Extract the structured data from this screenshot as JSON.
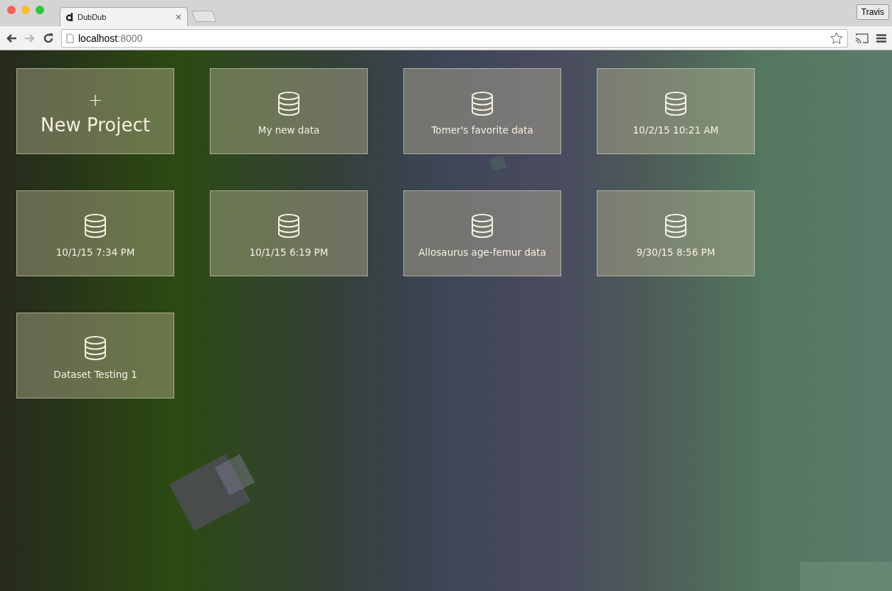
{
  "browser": {
    "tabs": [
      {
        "title": "DubDub",
        "selected": true
      }
    ],
    "profile": "Travis",
    "address": {
      "host": "localhost",
      "port": ":8000"
    }
  },
  "new_project": {
    "symbol": "+",
    "label": "New Project"
  },
  "datasets": [
    {
      "name": "My new data"
    },
    {
      "name": "Tomer's favorite data"
    },
    {
      "name": "10/2/15 10:21 AM"
    },
    {
      "name": "10/1/15 7:34 PM"
    },
    {
      "name": "10/1/15 6:19 PM"
    },
    {
      "name": "Allosaurus age-femur data"
    },
    {
      "name": "9/30/15 8:56 PM"
    },
    {
      "name": "Dataset Testing 1"
    }
  ]
}
